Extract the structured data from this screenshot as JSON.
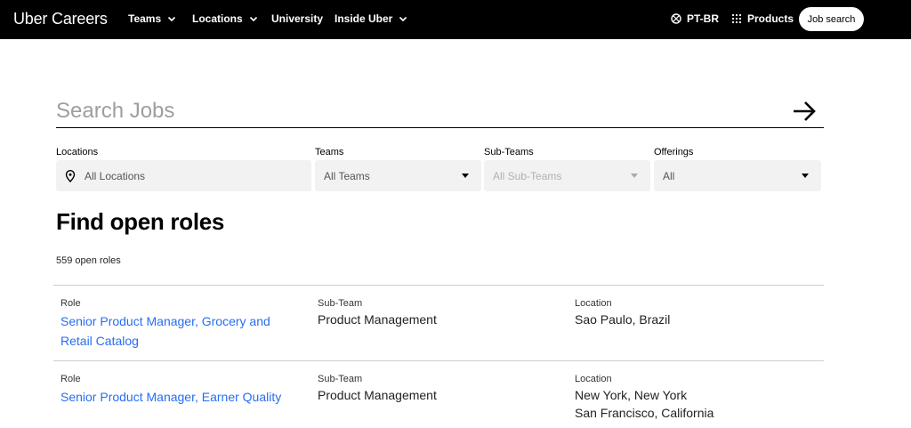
{
  "nav": {
    "brand": "Uber Careers",
    "items": [
      {
        "label": "Teams"
      },
      {
        "label": "Locations"
      },
      {
        "label": "University"
      },
      {
        "label": "Inside Uber"
      }
    ],
    "language": "PT-BR",
    "products": "Products",
    "job_search": "Job search"
  },
  "search": {
    "placeholder": "Search Jobs",
    "value": ""
  },
  "filters": {
    "locations": {
      "label": "Locations",
      "value": "All Locations"
    },
    "teams": {
      "label": "Teams",
      "value": "All Teams"
    },
    "subteams": {
      "label": "Sub-Teams",
      "value": "All Sub-Teams"
    },
    "offerings": {
      "label": "Offerings",
      "value": "All"
    }
  },
  "main": {
    "title": "Find open roles",
    "count": "559 open roles"
  },
  "table": {
    "headers": {
      "role": "Role",
      "subteam": "Sub-Team",
      "location": "Location"
    },
    "rows": [
      {
        "role": "Senior Product Manager, Grocery and Retail Catalog",
        "subteam": "Product Management",
        "locations": [
          "Sao Paulo, Brazil"
        ]
      },
      {
        "role": "Senior Product Manager, Earner Quality",
        "subteam": "Product Management",
        "locations": [
          "New York, New York",
          "San Francisco, California"
        ]
      }
    ]
  },
  "colors": {
    "link": "#276ef1",
    "nav_bg": "#000000"
  }
}
